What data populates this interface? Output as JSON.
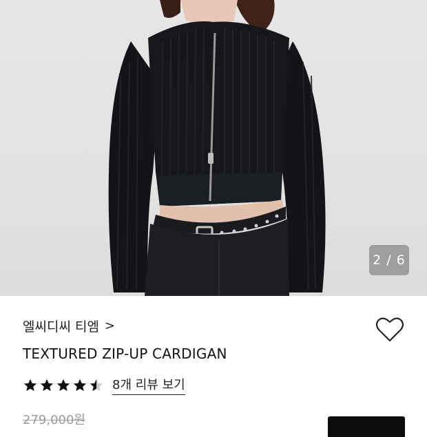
{
  "gallery": {
    "counter": "2 / 6",
    "image_alt": "Model wearing black textured zip-up cardigan"
  },
  "product": {
    "brand": "엘씨디씨 티엠",
    "brand_chevron": ">",
    "name": "TEXTURED ZIP-UP CARDIGAN",
    "rating": 4.5,
    "stars_max": 5,
    "review_link": "8개 리뷰 보기",
    "original_price": "279,000원"
  },
  "icons": {
    "wishlist": "heart-outline-icon",
    "star_full": "star-filled-icon",
    "star_half": "star-half-icon"
  },
  "colors": {
    "background": "#ffffff",
    "text": "#111111",
    "muted": "#9a9a9a",
    "button": "#0b0b0b"
  }
}
